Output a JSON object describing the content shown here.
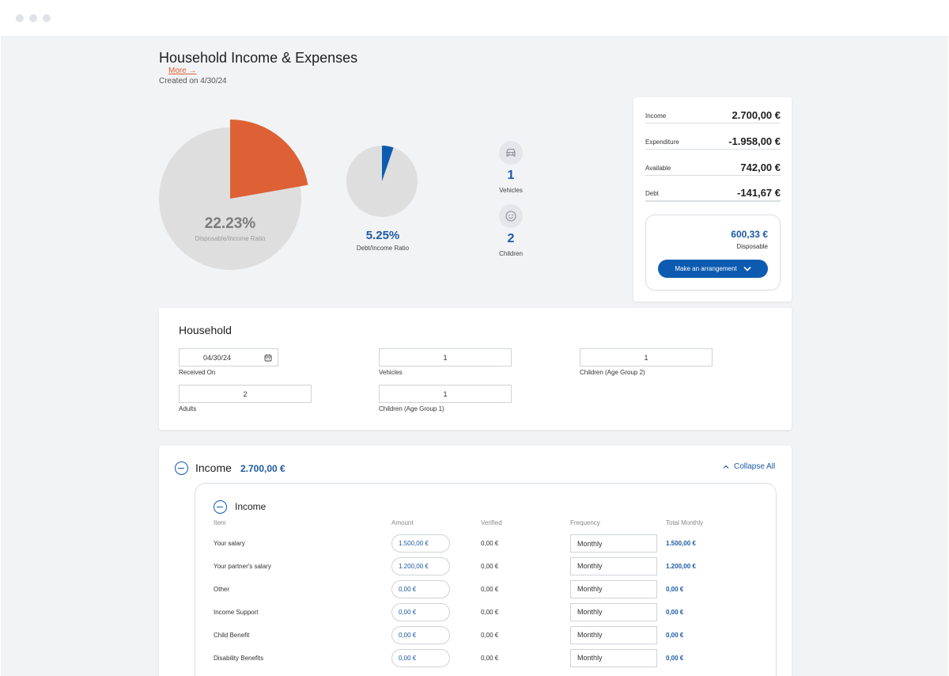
{
  "page": {
    "title": "Household Income & Expenses",
    "more_link": "More →",
    "created": "Created on 4/30/24"
  },
  "stats": {
    "disposable_ratio": {
      "pct": "22.23%",
      "label": "Disposable/Income Ratio",
      "value": 0.2223
    },
    "debt_ratio": {
      "pct": "5.25%",
      "label": "Debt/Income Ratio",
      "value": 0.0525
    },
    "vehicles": {
      "count": "1",
      "label": "Vehicles",
      "icon": "car-icon"
    },
    "children": {
      "count": "2",
      "label": "Children",
      "icon": "smiley-icon"
    }
  },
  "summary": {
    "rows": [
      {
        "label": "Income",
        "value": "2.700,00 €"
      },
      {
        "label": "Expenditure",
        "value": "-1.958,00 €"
      },
      {
        "label": "Available",
        "value": "742,00 €"
      },
      {
        "label": "Debt",
        "value": "-141,67 €"
      }
    ],
    "disposable_value": "600,33 €",
    "disposable_label": "Disposable",
    "arrange_button": "Make an arrangement"
  },
  "household": {
    "title": "Household",
    "received_on": {
      "value": "04/30/24",
      "label": "Received On"
    },
    "vehicles": {
      "value": "1",
      "label": "Vehicles"
    },
    "children_group2": {
      "value": "1",
      "label": "Children (Age Group 2)"
    },
    "adults": {
      "value": "2",
      "label": "Adults"
    },
    "children_group1": {
      "value": "1",
      "label": "Children (Age Group 1)"
    }
  },
  "income": {
    "title": "Income",
    "total": "2.700,00 €",
    "collapse_all": "Collapse All",
    "sub_title": "Income",
    "columns": [
      "Item",
      "Amount",
      "Verified",
      "Frequency",
      "Total Monthly"
    ],
    "rows": [
      {
        "item": "Your salary",
        "amount": "1.500,00 €",
        "verified": "0,00 €",
        "frequency": "Monthly",
        "total": "1.500,00 €"
      },
      {
        "item": "Your partner's salary",
        "amount": "1.200,00 €",
        "verified": "0,00 €",
        "frequency": "Monthly",
        "total": "1.200,00 €"
      },
      {
        "item": "Other",
        "amount": "0,00 €",
        "verified": "0,00 €",
        "frequency": "Monthly",
        "total": "0,00 €"
      },
      {
        "item": "Income Support",
        "amount": "0,00 €",
        "verified": "0,00 €",
        "frequency": "Monthly",
        "total": "0,00 €"
      },
      {
        "item": "Child Benefit",
        "amount": "0,00 €",
        "verified": "0,00 €",
        "frequency": "Monthly",
        "total": "0,00 €"
      },
      {
        "item": "Disability Benefits",
        "amount": "0,00 €",
        "verified": "0,00 €",
        "frequency": "Monthly",
        "total": "0,00 €"
      }
    ]
  },
  "colors": {
    "accent_blue": "#0d5bb0",
    "value_blue": "#1d5aa6",
    "orange": "#dd6135",
    "pie_gray": "#dedede",
    "background": "#f2f3f5"
  }
}
